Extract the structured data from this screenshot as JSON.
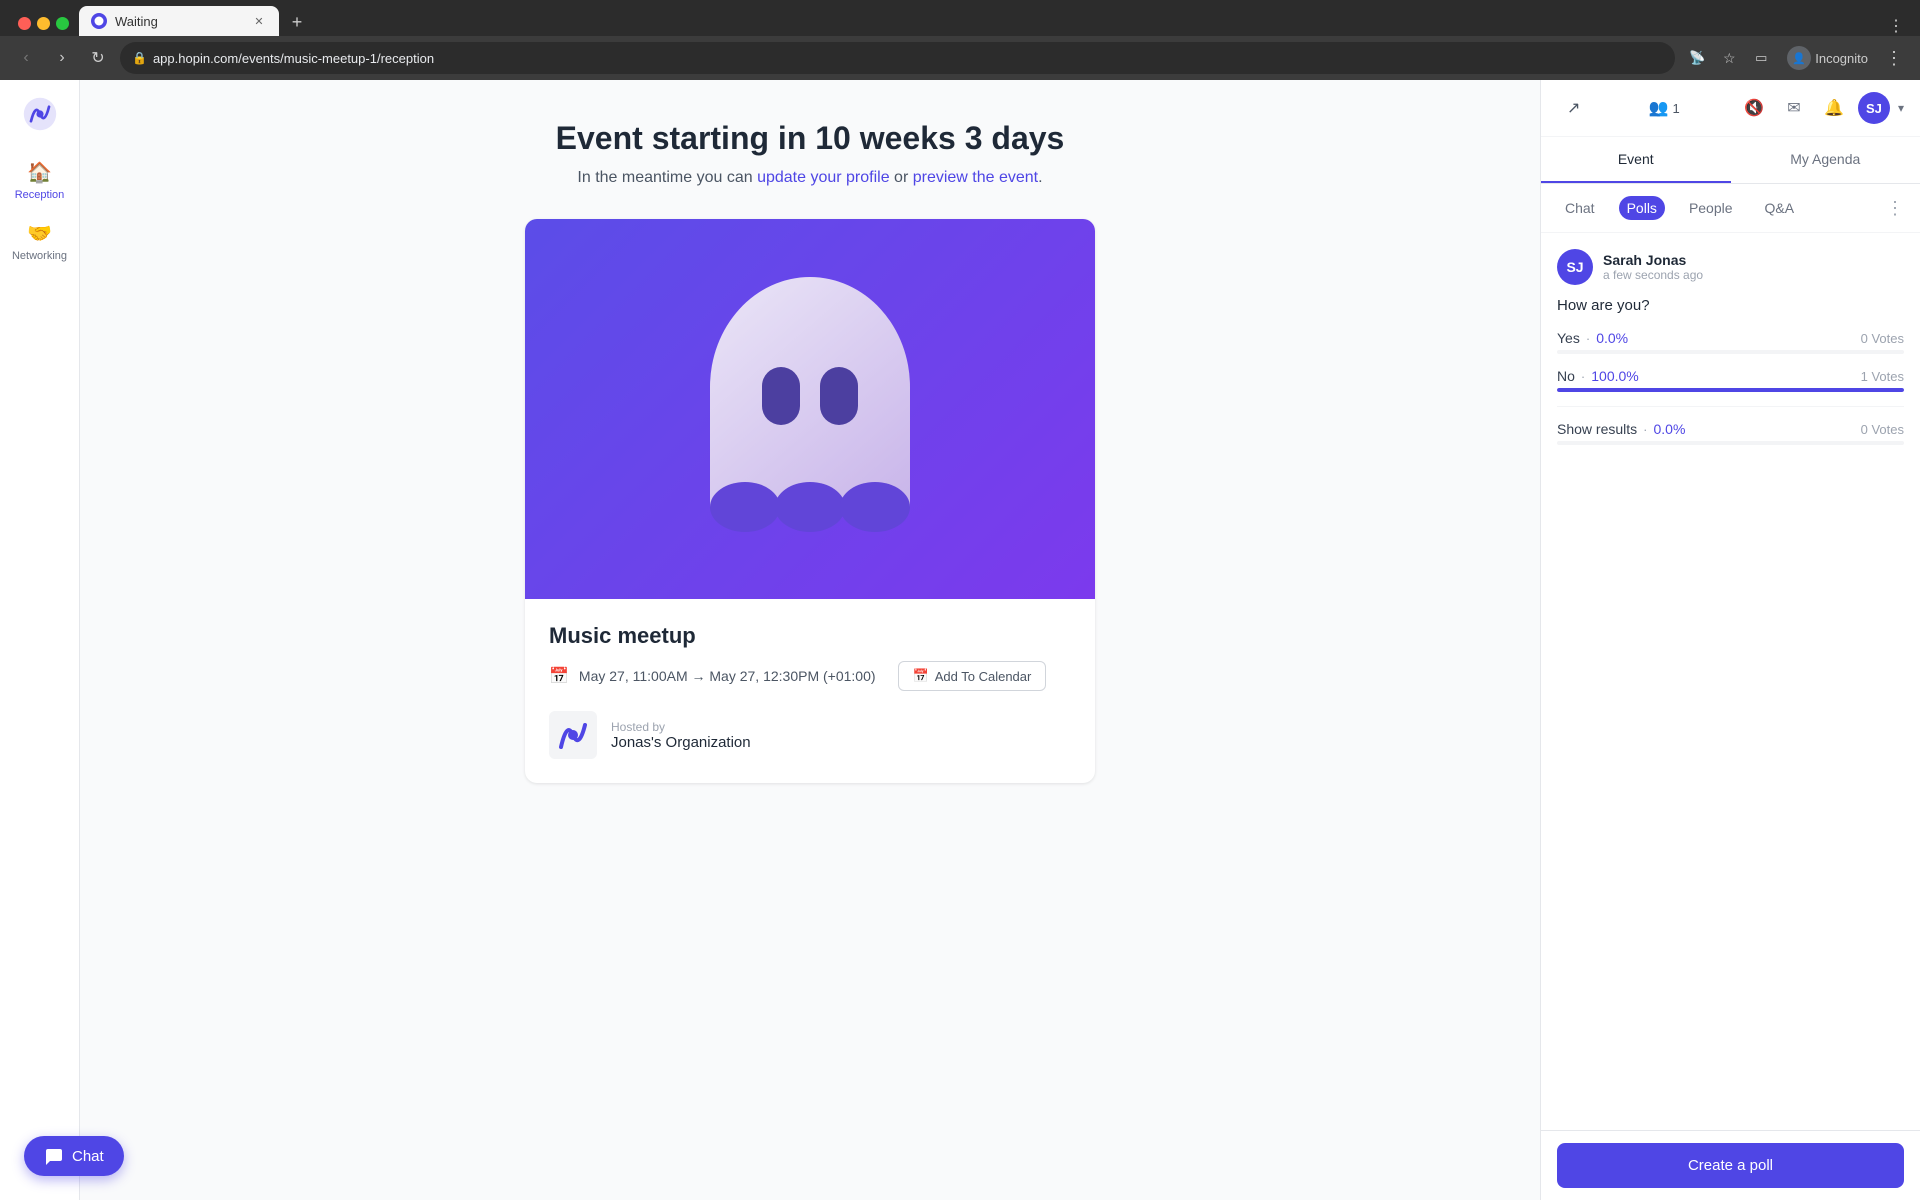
{
  "browser": {
    "tab_title": "Waiting",
    "address": "app.hopin.com/events/music-meetup-1/reception",
    "profile_label": "Incognito"
  },
  "sidebar": {
    "logo_alt": "Hopin logo",
    "items": [
      {
        "id": "reception",
        "label": "Reception",
        "icon": "🏠",
        "active": true
      },
      {
        "id": "networking",
        "label": "Networking",
        "icon": "🤝",
        "active": false
      }
    ]
  },
  "main": {
    "countdown_text": "Event starting in 10 weeks 3 days",
    "subtitle_prefix": "In the meantime you can ",
    "update_profile_link": "update your profile",
    "or_text": " or ",
    "preview_event_link": "preview the event",
    "subtitle_suffix": ".",
    "event": {
      "name": "Music meetup",
      "date_text": "May 27, 11:00AM → May 27, 12:30PM (+01:00)",
      "add_calendar_label": "Add To Calendar",
      "hosted_by_label": "Hosted by",
      "host_name": "Jonas's Organization"
    }
  },
  "right_panel": {
    "attendee_count": "1",
    "tabs": [
      {
        "id": "event",
        "label": "Event",
        "active": true
      },
      {
        "id": "my_agenda",
        "label": "My Agenda",
        "active": false
      }
    ],
    "sub_tabs": [
      {
        "id": "chat",
        "label": "Chat",
        "active": false
      },
      {
        "id": "polls",
        "label": "Polls",
        "active": true
      },
      {
        "id": "people",
        "label": "People",
        "active": false
      },
      {
        "id": "qa",
        "label": "Q&A",
        "active": false
      }
    ],
    "poll": {
      "author_initials": "SJ",
      "author_name": "Sarah Jonas",
      "author_time": "a few seconds ago",
      "question": "How are you?",
      "options": [
        {
          "label": "Yes",
          "pct": "0.0%",
          "votes": "0 Votes",
          "fill_pct": 0
        },
        {
          "label": "No",
          "pct": "100.0%",
          "votes": "1 Votes",
          "fill_pct": 100
        },
        {
          "label": "Show results",
          "pct": "0.0%",
          "votes": "0 Votes",
          "fill_pct": 0
        }
      ]
    },
    "create_poll_label": "Create a poll"
  },
  "chat_widget": {
    "label": "Chat"
  }
}
